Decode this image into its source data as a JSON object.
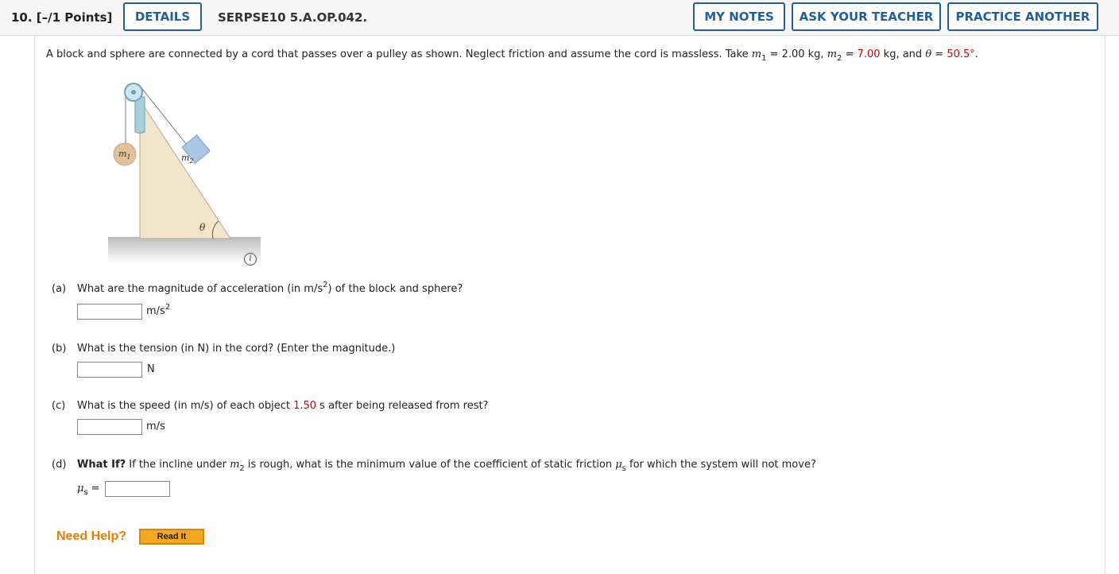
{
  "header": {
    "question_number": "10. [–/1 Points]",
    "details": "DETAILS",
    "question_id": "SERPSE10 5.A.OP.042.",
    "my_notes": "MY NOTES",
    "ask_teacher": "ASK YOUR TEACHER",
    "practice_another": "PRACTICE ANOTHER"
  },
  "problem": {
    "intro": "A block and sphere are connected by a cord that passes over a pulley as shown. Neglect friction and assume the cord is massless. Take ",
    "m1_sym": "m",
    "m1_sub": "1",
    "m1_eq": " = 2.00 kg, ",
    "m2_sym": "m",
    "m2_sub": "2",
    "m2_eq": " = ",
    "m2_val": "7.00",
    "m2_unit": " kg, and ",
    "theta_sym": "θ",
    "theta_eq": " = ",
    "theta_val": "50.5°",
    "end": "."
  },
  "figure": {
    "m1_label": "m",
    "m1_sub": "1",
    "m2_label": "m",
    "m2_sub": "2",
    "theta_label": "θ",
    "info_icon": "i"
  },
  "parts": {
    "a": {
      "label": "(a)",
      "q1": "What are the magnitude of acceleration (in m/s",
      "q_sup": "2",
      "q2": ") of the block and sphere?",
      "unit": "m/s",
      "unit_sup": "2"
    },
    "b": {
      "label": "(b)",
      "q": "What is the tension (in N) in the cord? (Enter the magnitude.)",
      "unit": "N"
    },
    "c": {
      "label": "(c)",
      "q1": "What is the speed (in m/s) of each object ",
      "q_val": "1.50",
      "q2": " s after being released from rest?",
      "unit": "m/s"
    },
    "d": {
      "label": "(d)",
      "bold": "What If?",
      "q1": " If the incline under ",
      "m_sym": "m",
      "m_sub": "2",
      "q2": " is rough, what is the minimum value of the coefficient of static friction ",
      "mu": "μ",
      "mu_sub": "s",
      "q3": " for which the system will not move?",
      "lhs_mu": "μ",
      "lhs_sub": "s",
      "lhs_eq": " ="
    }
  },
  "help": {
    "need_help": "Need Help?",
    "read_it": "Read It"
  },
  "colors": {
    "accent": "#1f5f9c",
    "value_red": "#c00000",
    "help_orange": "#e67e00"
  }
}
